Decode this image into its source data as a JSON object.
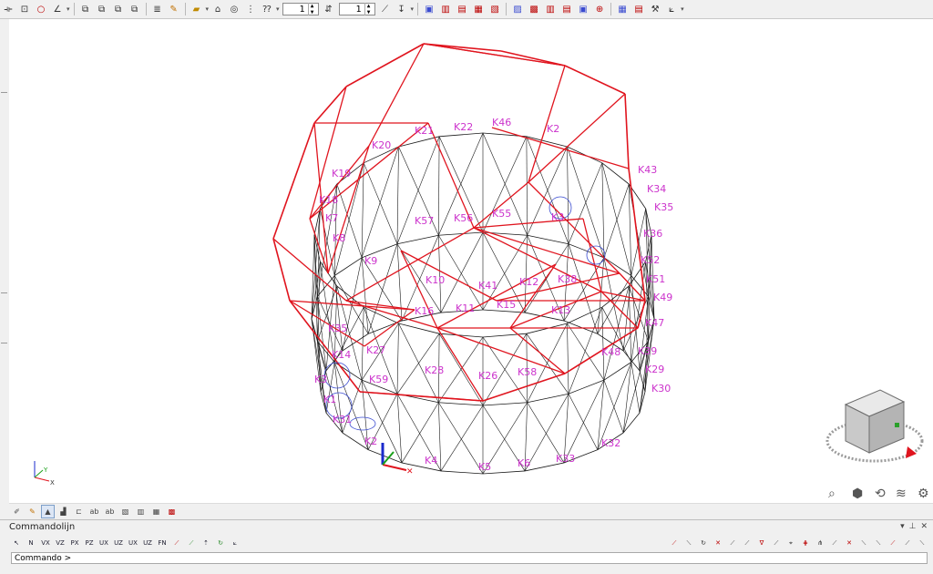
{
  "toolbar": {
    "icons_group1": [
      "ruler-icon",
      "rectangle-icon",
      "circle-icon",
      "angle-icon"
    ],
    "icons_group2": [
      "copy-layer-icon",
      "copy-layer-2-icon",
      "copy-layer-3-icon",
      "copy-layer-4-icon"
    ],
    "icons_group3": [
      "layer-icon",
      "draw-tool-icon"
    ],
    "spinner1_value": "1",
    "spinner2_value": "1",
    "icons_group4": [
      "snap-icon",
      "snap-2-icon",
      "snap-3-icon",
      "snap-4-icon",
      "snap-5-icon",
      "snap-6-icon",
      "snap-7-icon",
      "snap-8-icon",
      "snap-9-icon",
      "snap-10-icon",
      "target-icon"
    ],
    "icons_group5": [
      "save-icon",
      "print-icon",
      "settings-icon",
      "measure-icon"
    ]
  },
  "drawing": {
    "colors": {
      "labels": "#cc33cc",
      "red_mesh": "#e0141e",
      "black_mesh": "#1a1a1a",
      "blue": "#3a4bd0"
    },
    "labels": [
      "K21",
      "K22",
      "K46",
      "K2",
      "K20",
      "K43",
      "K19",
      "K34",
      "K18",
      "K35",
      "K7",
      "K57",
      "K56",
      "K55",
      "K3",
      "K36",
      "K8",
      "K52",
      "K9",
      "K10",
      "K41",
      "K12",
      "K38",
      "K51",
      "K49",
      "K16",
      "K11",
      "K15",
      "K13",
      "K47",
      "K35",
      "K14",
      "K27",
      "K48",
      "K39",
      "K59",
      "K28",
      "K26",
      "K58",
      "K29",
      "K30",
      "K1",
      "K31",
      "K2",
      "K3",
      "K32",
      "K4",
      "K5",
      "K6",
      "K33"
    ],
    "axis_labels": {
      "y": "Y",
      "x": "X"
    }
  },
  "viewcube": {
    "front_face": "",
    "tools": [
      "zoom-icon",
      "view-cube-icon",
      "orbit-icon",
      "pan-icon",
      "gear-icon"
    ]
  },
  "viewbar_icons": [
    "pencil-icon",
    "draw-icon",
    "ground-icon",
    "surface-icon",
    "section-icon",
    "abc-text-icon",
    "abc-text-2-icon",
    "pattern-icon",
    "table-icon",
    "grid-icon",
    "color-grid-icon"
  ],
  "command": {
    "title": "Commandolijn",
    "prompt": "Commando >",
    "tools_left": [
      "N",
      "VX",
      "VZ",
      "PX",
      "PZ",
      "UX",
      "UZ",
      "UX",
      "UZ",
      "FN"
    ],
    "tools_right_count": 18
  }
}
